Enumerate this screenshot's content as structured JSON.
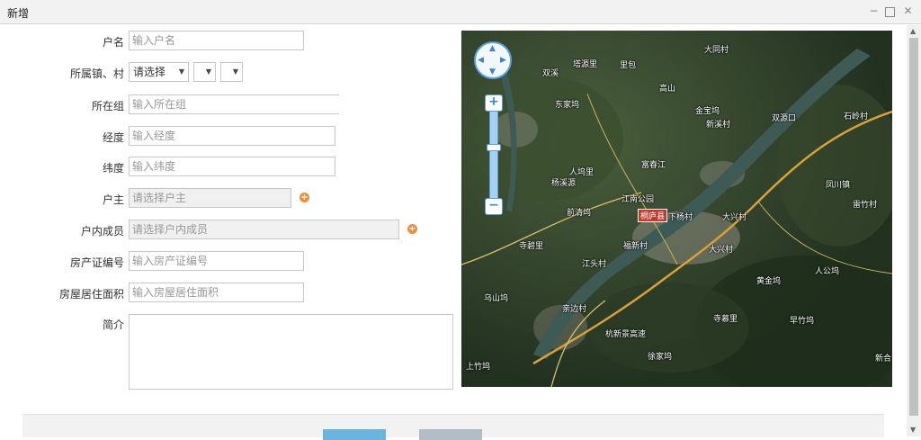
{
  "window": {
    "title": "新增"
  },
  "form": {
    "household_name": {
      "label": "户名",
      "placeholder": "输入户名"
    },
    "location": {
      "label": "所属镇、村",
      "select1": "请选择",
      "select2": "",
      "select3": ""
    },
    "group": {
      "label": "所在组",
      "placeholder": "输入所在组"
    },
    "longitude": {
      "label": "经度",
      "placeholder": "输入经度"
    },
    "latitude": {
      "label": "纬度",
      "placeholder": "输入纬度"
    },
    "owner": {
      "label": "户主",
      "placeholder": "请选择户主"
    },
    "members": {
      "label": "户内成员",
      "placeholder": "请选择户内成员"
    },
    "cert_no": {
      "label": "房产证编号",
      "placeholder": "输入房产证编号"
    },
    "area": {
      "label": "房屋居住面积",
      "placeholder": "输入房屋居住面积"
    },
    "intro": {
      "label": "简介",
      "value": ""
    }
  },
  "map": {
    "labels": [
      "大同村",
      "塔源里",
      "里包",
      "双溪",
      "东家坞",
      "高山",
      "金宝坞",
      "新溪村",
      "石岭村",
      "双源口",
      "人坞里",
      "杨溪源",
      "江南公园",
      "下杨村",
      "大兴村",
      "前清坞",
      "寺碧里",
      "江头村",
      "福新村",
      "乌山坞",
      "亲边村",
      "黄金坞",
      "人公坞",
      "寺慕里",
      "早竹坞",
      "徐家坞",
      "上竹坞",
      "凤川镇",
      "雷竹村",
      "新合",
      "桐庐县",
      "大兴村",
      "富春江",
      "杭新景高速"
    ]
  },
  "colors": {
    "accent_button": "#6cb4e0",
    "secondary_button": "#b0bcc6",
    "add_icon": "#f08c3c"
  }
}
